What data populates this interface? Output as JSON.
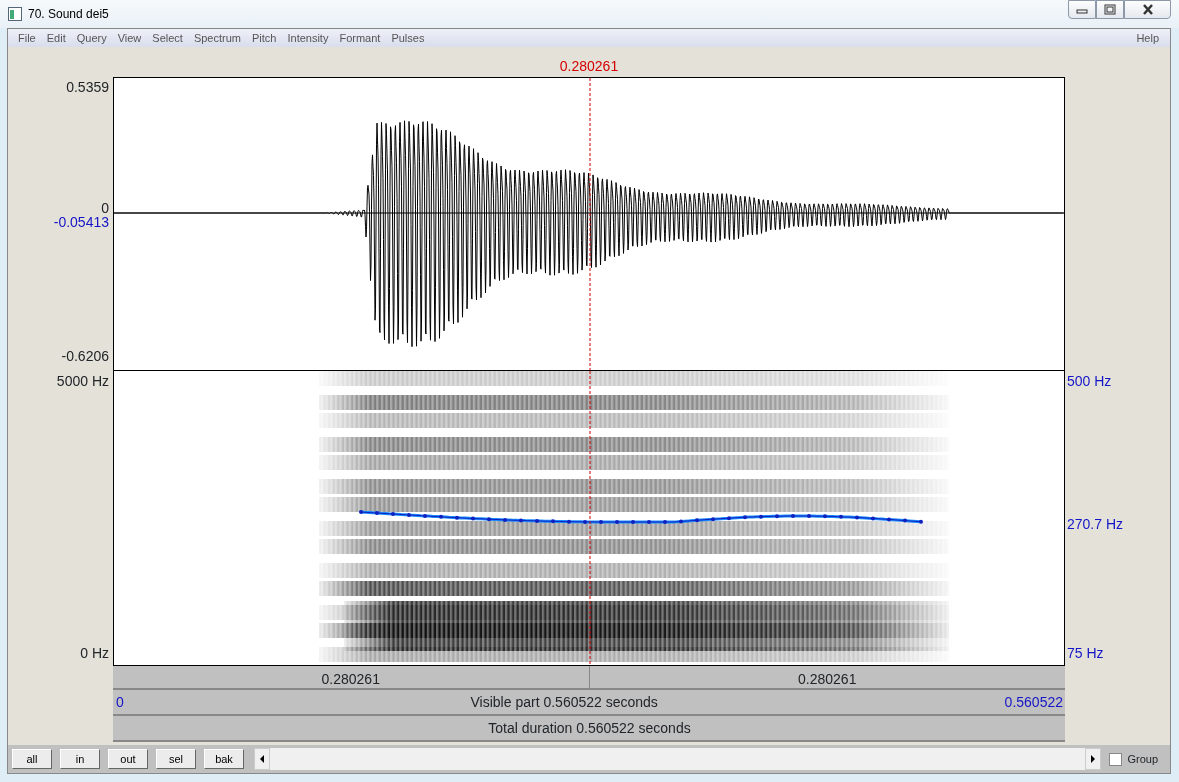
{
  "window": {
    "title": "70. Sound dei5"
  },
  "menu": {
    "items": [
      "File",
      "Edit",
      "Query",
      "View",
      "Select",
      "Spectrum",
      "Pitch",
      "Intensity",
      "Formant",
      "Pulses"
    ],
    "help": "Help"
  },
  "cursor": {
    "time": "0.280261"
  },
  "waveform": {
    "ymax": "0.5359",
    "zero": "0",
    "cursor_value": "-0.05413",
    "ymin": "-0.6206"
  },
  "spectrogram": {
    "fmax": "5000 Hz",
    "fmin": "0 Hz",
    "pitch_max": "500 Hz",
    "pitch_value": "270.7 Hz",
    "pitch_min": "75 Hz"
  },
  "time_bar": {
    "segments": [
      "0.280261",
      "0.280261"
    ]
  },
  "visible": {
    "start": "0",
    "label": "Visible part 0.560522 seconds",
    "end": "0.560522"
  },
  "total": {
    "label": "Total duration 0.560522 seconds"
  },
  "buttons": [
    "all",
    "in",
    "out",
    "sel",
    "bak"
  ],
  "group": {
    "label": "Group",
    "checked": false
  }
}
